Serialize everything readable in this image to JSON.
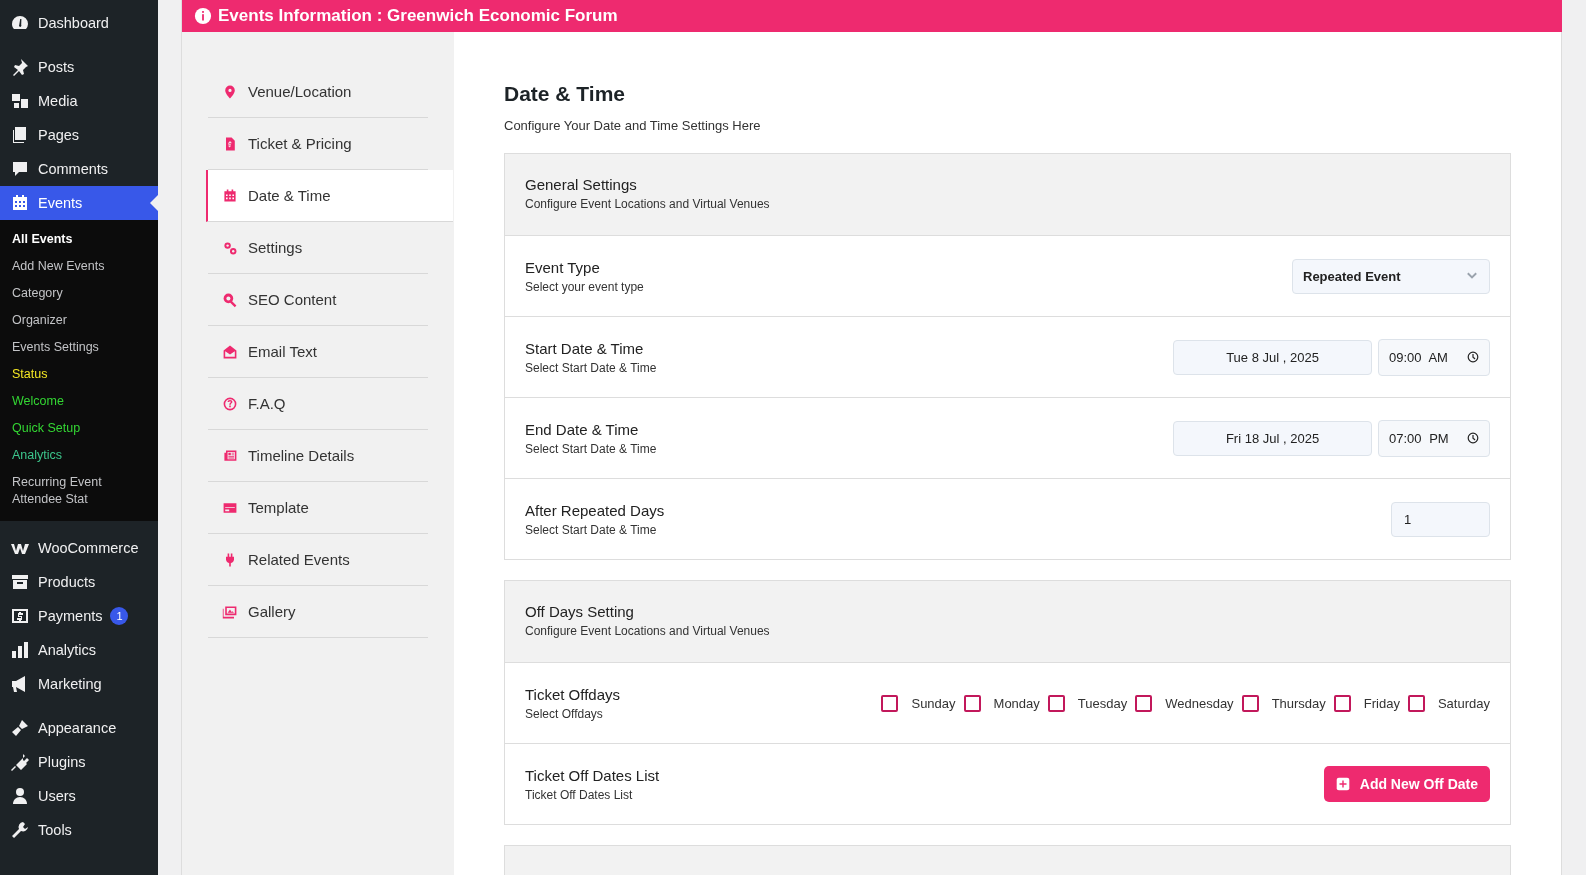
{
  "admin_menu": {
    "groups": [
      {
        "items": [
          {
            "label": "Dashboard",
            "selected": false
          }
        ]
      },
      {
        "items": [
          {
            "label": "Posts",
            "selected": false
          },
          {
            "label": "Media",
            "selected": false
          },
          {
            "label": "Pages",
            "selected": false
          },
          {
            "label": "Comments",
            "selected": false
          },
          {
            "label": "Events",
            "selected": true,
            "submenu": [
              {
                "label": "All Events",
                "selected": true,
                "color": "#ffffff"
              },
              {
                "label": "Add New Events",
                "selected": false,
                "color": "#c3c4c7"
              },
              {
                "label": "Category",
                "selected": false,
                "color": "#c3c4c7"
              },
              {
                "label": "Organizer",
                "selected": false,
                "color": "#c3c4c7"
              },
              {
                "label": "Events Settings",
                "selected": false,
                "color": "#c3c4c7"
              },
              {
                "label": "Status",
                "selected": false,
                "color": "#f3e623"
              },
              {
                "label": "Welcome",
                "selected": false,
                "color": "#33d633"
              },
              {
                "label": "Quick Setup",
                "selected": false,
                "color": "#33d633"
              },
              {
                "label": "Analytics",
                "selected": false,
                "color": "#3cc68c"
              },
              {
                "label": "Recurring Event Attendee Stat",
                "selected": false,
                "color": "#c3c4c7"
              }
            ]
          }
        ]
      },
      {
        "items": [
          {
            "label": "WooCommerce",
            "selected": false
          },
          {
            "label": "Products",
            "selected": false
          },
          {
            "label": "Payments",
            "selected": false,
            "badge": "1"
          },
          {
            "label": "Analytics",
            "selected": false
          },
          {
            "label": "Marketing",
            "selected": false
          }
        ]
      },
      {
        "items": [
          {
            "label": "Appearance",
            "selected": false
          },
          {
            "label": "Plugins",
            "selected": false
          },
          {
            "label": "Users",
            "selected": false
          },
          {
            "label": "Tools",
            "selected": false
          }
        ]
      }
    ]
  },
  "page_header": {
    "title": "Events Information : Greenwich Economic Forum"
  },
  "tabs": [
    {
      "label": "Venue/Location",
      "selected": false
    },
    {
      "label": "Ticket & Pricing",
      "selected": false
    },
    {
      "label": "Date & Time",
      "selected": true
    },
    {
      "label": "Settings",
      "selected": false
    },
    {
      "label": "SEO Content",
      "selected": false
    },
    {
      "label": "Email Text",
      "selected": false
    },
    {
      "label": "F.A.Q",
      "selected": false
    },
    {
      "label": "Timeline Details",
      "selected": false
    },
    {
      "label": "Template",
      "selected": false
    },
    {
      "label": "Related Events",
      "selected": false
    },
    {
      "label": "Gallery",
      "selected": false
    }
  ],
  "content": {
    "title": "Date & Time",
    "subtitle": "Configure Your Date and Time Settings Here",
    "sections": [
      {
        "title": "General Settings",
        "subtitle": "Configure Event Locations and Virtual Venues",
        "rows": [
          {
            "kind": "select",
            "label": "Event Type",
            "hint": "Select your event type",
            "value": "Repeated Event"
          },
          {
            "kind": "datetime",
            "label": "Start Date & Time",
            "hint": "Select Start Date & Time",
            "date": "Tue 8 Jul , 2025",
            "time": "09:00 AM"
          },
          {
            "kind": "datetime",
            "label": "End Date & Time",
            "hint": "Select Start Date & Time",
            "date": "Fri 18 Jul , 2025",
            "time": "07:00 PM"
          },
          {
            "kind": "number",
            "label": "After Repeated Days",
            "hint": "Select Start Date & Time",
            "value": "1"
          }
        ]
      },
      {
        "title": "Off Days Setting",
        "subtitle": "Configure Event Locations and Virtual Venues",
        "rows": [
          {
            "kind": "checkboxes",
            "label": "Ticket Offdays",
            "hint": "Select Offdays",
            "options": [
              {
                "label": "Sunday",
                "checked": false
              },
              {
                "label": "Monday",
                "checked": false
              },
              {
                "label": "Tuesday",
                "checked": false
              },
              {
                "label": "Wednesday",
                "checked": false
              },
              {
                "label": "Thursday",
                "checked": false
              },
              {
                "label": "Friday",
                "checked": false
              },
              {
                "label": "Saturday",
                "checked": false
              }
            ]
          },
          {
            "kind": "button",
            "label": "Ticket Off Dates List",
            "hint": "Ticket Off Dates List",
            "button": "Add New Off Date"
          }
        ]
      }
    ]
  }
}
